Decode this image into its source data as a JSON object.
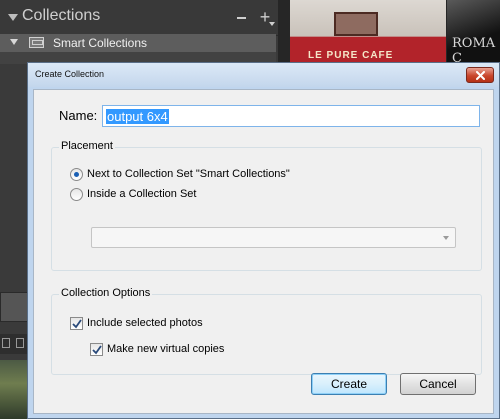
{
  "background": {
    "panel_title": "Collections",
    "smart_collections_label": "Smart Collections",
    "photo_sign": "LE PURE CAFE",
    "photo2_text": "ROMA C"
  },
  "dialog": {
    "title": "Create Collection",
    "name_label": "Name:",
    "name_value": "output 6x4",
    "placement": {
      "legend": "Placement",
      "options": [
        {
          "label": "Next to Collection Set \"Smart Collections\"",
          "checked": true
        },
        {
          "label": "Inside a Collection Set",
          "checked": false
        }
      ],
      "collection_set_value": ""
    },
    "collection_options": {
      "legend": "Collection Options",
      "include_selected_photos": {
        "label": "Include selected photos",
        "checked": true
      },
      "make_virtual_copies": {
        "label": "Make new virtual copies",
        "checked": true
      }
    },
    "buttons": {
      "create": "Create",
      "cancel": "Cancel"
    }
  },
  "colors": {
    "accent": "#3399ff",
    "close_button": "#c9462c",
    "lightroom_panel": "#3a3a3a"
  }
}
